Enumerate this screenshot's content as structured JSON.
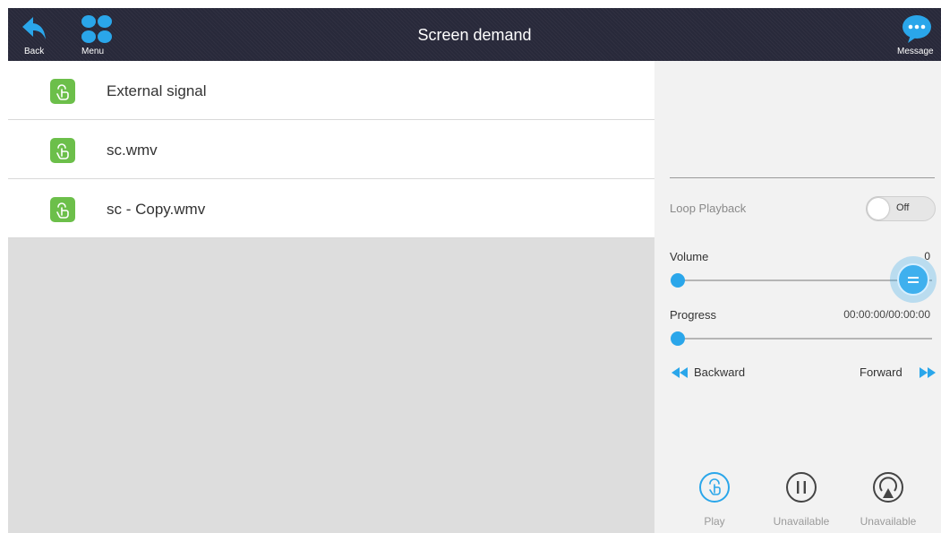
{
  "header": {
    "title": "Screen demand",
    "back_label": "Back",
    "menu_label": "Menu",
    "message_label": "Message"
  },
  "list": {
    "items": [
      {
        "label": "External signal",
        "icon": "touch-hand-icon"
      },
      {
        "label": "sc.wmv",
        "icon": "touch-hand-icon"
      },
      {
        "label": "sc - Copy.wmv",
        "icon": "touch-hand-icon"
      }
    ]
  },
  "controls": {
    "loop_label": "Loop Playback",
    "loop_state": "Off",
    "volume_label": "Volume",
    "volume_value": "0",
    "volume_level": 0,
    "progress_label": "Progress",
    "progress_time": "00:00:00/00:00:00",
    "progress_level": 0,
    "backward_label": "Backward",
    "forward_label": "Forward",
    "play_label": "Play",
    "pause_label": "Unavailable",
    "cast_label": "Unavailable"
  },
  "colors": {
    "accent": "#2aa6ea",
    "header_bg": "#28293a",
    "list_icon": "#6cbf4a",
    "muted_text": "#9a9a9a"
  }
}
